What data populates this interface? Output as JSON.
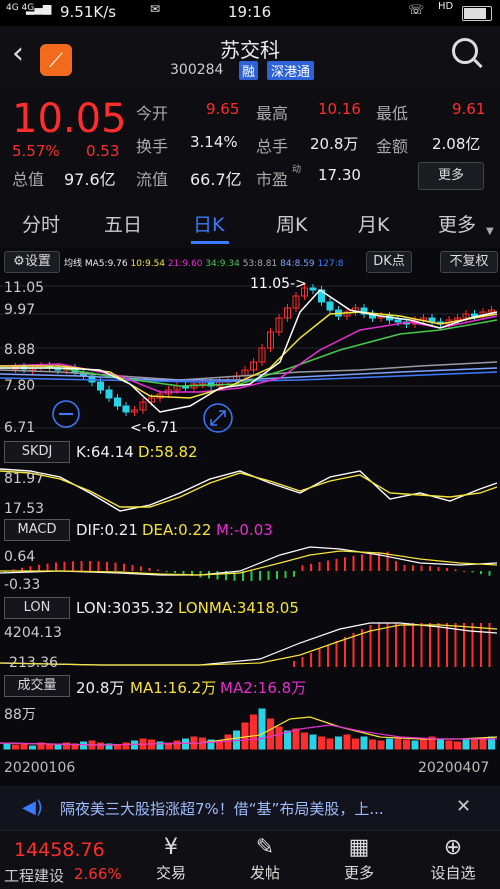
{
  "status": {
    "carrier": "4G 4G",
    "speed": "9.51K/s",
    "time": "19:16",
    "hd": "HD"
  },
  "header": {
    "title": "苏交科",
    "code": "300284",
    "tag1": "融",
    "tag2": "深港通"
  },
  "quote": {
    "price": "10.05",
    "pct": "5.57%",
    "chg": "0.53",
    "open_label": "今开",
    "open": "9.65",
    "high_label": "最高",
    "high": "10.16",
    "low_label": "最低",
    "low": "9.61",
    "turnover_label": "换手",
    "turnover": "3.14%",
    "vol_label": "总手",
    "vol": "20.8万",
    "amount_label": "金额",
    "amount": "2.08亿",
    "mcap_label": "总值",
    "mcap": "97.6亿",
    "float_label": "流值",
    "float": "66.7亿",
    "pe_label": "市盈",
    "pe_sup": "动",
    "pe": "17.30",
    "more": "更多"
  },
  "tabs": [
    "分时",
    "五日",
    "日K",
    "周K",
    "月K",
    "更多"
  ],
  "active_tab": "日K",
  "toolbar": {
    "settings": "设置",
    "ma_title": "均线",
    "ma5": "MA5:9.76",
    "ma10": "10:9.54",
    "ma20": "21:9.60",
    "ma30": "34:9.34",
    "ma60": "53:8.81",
    "ma120": "84:8.59",
    "ma250": "127:8",
    "dk": "DK点",
    "adjust": "不复权"
  },
  "kline": {
    "y_max": "11.05",
    "y2": "9.97",
    "y3": "8.88",
    "y4": "7.80",
    "y_min": "6.71",
    "hi_note": "11.05->",
    "lo_note": "<-6.71"
  },
  "skdj": {
    "name": "SKDJ",
    "k": "K:64.14",
    "d": "D:58.82",
    "y_top": "81.97",
    "y_bot": "17.53"
  },
  "macd": {
    "name": "MACD",
    "dif": "DIF:0.21",
    "dea": "DEA:0.22",
    "m": "M:-0.03",
    "y_top": "0.64",
    "y_bot": "-0.33"
  },
  "lon": {
    "name": "LON",
    "lon": "LON:3035.32",
    "lonma": "LONMA:3418.05",
    "y_top": "4204.13",
    "y_bot": "-213.36"
  },
  "volume": {
    "name": "成交量",
    "vol": "20.8万",
    "ma1": "MA1:16.2万",
    "ma2": "MA2:16.8万",
    "y_top": "88万"
  },
  "dates": {
    "start": "20200106",
    "end": "20200407"
  },
  "ticker": {
    "text": "隔夜美三大股指涨超7%！借“基”布局美股，上..."
  },
  "index": {
    "value": "14458.76",
    "name": "工程建设",
    "pct": "2.66%"
  },
  "nav": [
    "交易",
    "发帖",
    "更多",
    "设自选"
  ],
  "colors": {
    "up": "#ff2d2d",
    "down": "#27d3e6",
    "accent": "#3b7bff"
  }
}
